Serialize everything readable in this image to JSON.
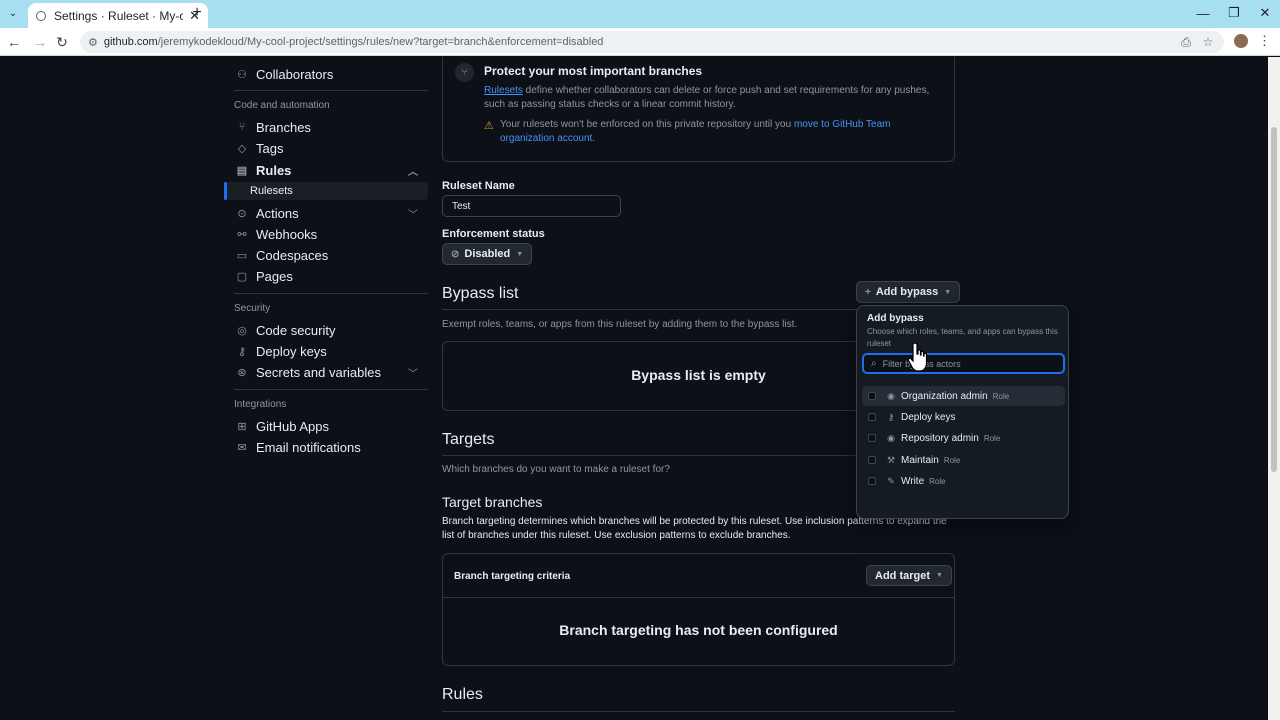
{
  "browser": {
    "tab_title": "Settings · Ruleset · My-cool-pro",
    "url_host": "github.com",
    "url_path": "/jeremykodekloud/My-cool-project/settings/rules/new?target=branch&enforcement=disabled"
  },
  "sidebar": {
    "collaborators": "Collaborators",
    "code_automation_heading": "Code and automation",
    "branches": "Branches",
    "tags": "Tags",
    "rules": "Rules",
    "rulesets": "Rulesets",
    "actions": "Actions",
    "webhooks": "Webhooks",
    "codespaces": "Codespaces",
    "pages": "Pages",
    "security_heading": "Security",
    "code_security": "Code security",
    "deploy_keys": "Deploy keys",
    "secrets": "Secrets and variables",
    "integrations_heading": "Integrations",
    "github_apps": "GitHub Apps",
    "email_notifications": "Email notifications"
  },
  "info": {
    "title": "Protect your most important branches",
    "rulesets_link": "Rulesets",
    "description": " define whether collaborators can delete or force push and set requirements for any pushes, such as passing status checks or a linear commit history.",
    "warning_text": "Your rulesets won't be enforced on this private repository until you ",
    "warning_link": "move to GitHub Team organization account",
    "warning_end": "."
  },
  "form": {
    "ruleset_name_label": "Ruleset Name",
    "ruleset_name_value": "Test",
    "enforcement_label": "Enforcement status",
    "enforcement_value": "Disabled"
  },
  "bypass": {
    "title": "Bypass list",
    "add_button": "Add bypass",
    "description": "Exempt roles, teams, or apps from this ruleset by adding them to the bypass list.",
    "empty": "Bypass list is empty"
  },
  "targets": {
    "title": "Targets",
    "description": "Which branches do you want to make a ruleset for?",
    "branches_title": "Target branches",
    "branches_desc": "Branch targeting determines which branches will be protected by this ruleset. Use inclusion patterns to expand the list of branches under this ruleset. Use exclusion patterns to exclude branches.",
    "criteria": "Branch targeting criteria",
    "add_target": "Add target",
    "not_configured": "Branch targeting has not been configured"
  },
  "rules": {
    "title": "Rules"
  },
  "overlay": {
    "title": "Add bypass",
    "subtitle": "Choose which roles, teams, and apps can bypass this ruleset",
    "search_placeholder": "Filter bypass actors",
    "options": [
      {
        "name": "Organization admin",
        "role": "Role",
        "icon": "eye-icon"
      },
      {
        "name": "Deploy keys",
        "role": "",
        "icon": "key-icon"
      },
      {
        "name": "Repository admin",
        "role": "Role",
        "icon": "eye-icon"
      },
      {
        "name": "Maintain",
        "role": "Role",
        "icon": "tools-icon"
      },
      {
        "name": "Write",
        "role": "Role",
        "icon": "pencil-icon"
      }
    ]
  },
  "colors": {
    "accent": "#1f6feb",
    "link": "#4493f8",
    "warning": "#d29922",
    "background": "#0d1117"
  }
}
